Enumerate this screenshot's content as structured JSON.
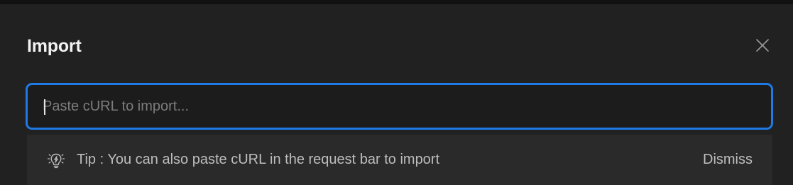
{
  "modal": {
    "title": "Import",
    "close_icon": "close-icon"
  },
  "input": {
    "value": "",
    "placeholder": "Paste cURL to import..."
  },
  "tip": {
    "icon": "lightbulb-icon",
    "text": "Tip : You can also paste cURL in the request bar to import",
    "dismiss_label": "Dismiss"
  },
  "colors": {
    "accent": "#1f7ae6",
    "background": "#212121",
    "tip_background": "#2a2a2a"
  }
}
